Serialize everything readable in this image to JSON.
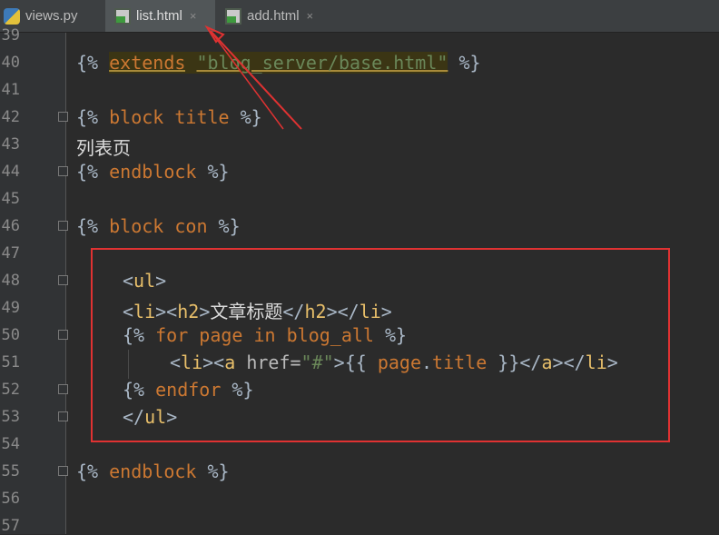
{
  "tabs": [
    {
      "label": "views.py",
      "icon": "python-file-icon",
      "active": false
    },
    {
      "label": "list.html",
      "icon": "html-file-icon",
      "active": true
    },
    {
      "label": "add.html",
      "icon": "html-file-icon",
      "active": false
    }
  ],
  "close_glyph": "×",
  "lines": [
    "39",
    "40",
    "41",
    "42",
    "43",
    "44",
    "45",
    "46",
    "47",
    "48",
    "49",
    "50",
    "51",
    "52",
    "53",
    "54",
    "55",
    "56",
    "57"
  ],
  "code": {
    "l40": {
      "open": "{% ",
      "kw": "extends",
      "sp": " ",
      "str": "\"blog_server/base.html\"",
      "close": " %}"
    },
    "l42": {
      "open": "{% ",
      "kw": "block title",
      "close": " %}"
    },
    "l43": {
      "text": "列表页"
    },
    "l44": {
      "open": "{% ",
      "kw": "endblock",
      "close": " %}"
    },
    "l46": {
      "open": "{% ",
      "kw": "block con",
      "close": " %}"
    },
    "l48": {
      "lt": "<",
      "tag": "ul",
      "gt": ">"
    },
    "l49": {
      "lt1": "<",
      "tag1": "li",
      "gt1": "><",
      "tag2": "h2",
      "gt2": ">",
      "text": "文章标题",
      "lt3": "</",
      "tag3": "h2",
      "gt3": "></",
      "tag4": "li",
      "gt4": ">"
    },
    "l50": {
      "open": "{% ",
      "kw1": "for",
      "var": " page ",
      "kw2": "in",
      "var2": " blog_all",
      "close": " %}"
    },
    "l51": {
      "lt1": "<",
      "tag1": "li",
      "gt1": "><",
      "tag2": "a",
      "attr": " href=",
      "str": "\"#\"",
      "gt2": ">",
      "expr": "{{ ",
      "var": "page",
      "dot": ".",
      "var2": "title",
      "expr_close": " }}",
      "lt3": "</",
      "tag3": "a",
      "gt3": "></",
      "tag4": "li",
      "gt4": ">"
    },
    "l52": {
      "open": "{% ",
      "kw": "endfor",
      "close": " %}"
    },
    "l53": {
      "lt": "</",
      "tag": "ul",
      "gt": ">"
    },
    "l55": {
      "open": "{% ",
      "kw": "endblock",
      "close": " %}"
    }
  },
  "colors": {
    "annotation": "#e03232",
    "background": "#2b2b2b",
    "keyword": "#cc7832",
    "tag": "#e8bf6a",
    "string": "#6a8759"
  }
}
